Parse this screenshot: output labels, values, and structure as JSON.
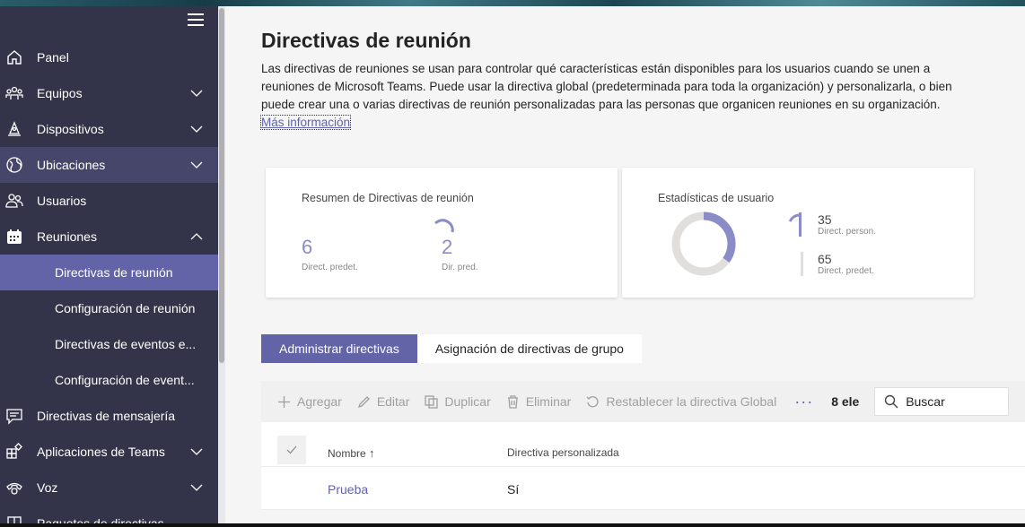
{
  "sidebar": {
    "items": [
      {
        "label": "Panel"
      },
      {
        "label": "Equipos"
      },
      {
        "label": "Dispositivos"
      },
      {
        "label": "Ubicaciones"
      },
      {
        "label": "Usuarios"
      },
      {
        "label": "Reuniones"
      },
      {
        "label": "Directivas de reunión"
      },
      {
        "label": "Configuración de reunión"
      },
      {
        "label": "Directivas de eventos e..."
      },
      {
        "label": "Configuración de event..."
      },
      {
        "label": "Directivas de mensajería"
      },
      {
        "label": "Aplicaciones de Teams"
      },
      {
        "label": "Voz"
      },
      {
        "label": "Paquetes de directivas"
      }
    ]
  },
  "page": {
    "title": "Directivas de reunión",
    "description": "Las directivas de reuniones se usan para controlar qué características están disponibles para los usuarios cuando se unen a reuniones de Microsoft Teams. Puede usar la directiva global (predeterminada para toda la organización) y personalizarla, o bien puede crear una o varias directivas de reunión personalizadas para las personas que organicen reuniones en su organización.",
    "more_info": "Más información"
  },
  "summary": {
    "title": "Resumen de Directivas de reunión",
    "default_value": "6",
    "default_label": "Direct. predet.",
    "pred_value": "2",
    "pred_label": "Dir. pred."
  },
  "user_stats": {
    "title": "Estadísticas de usuario",
    "custom_value": "35",
    "custom_label": "Direct. person.",
    "default_value": "65",
    "default_label": "Direct. predet.",
    "custom_fraction": 0.35,
    "accent": "#8b8cc7"
  },
  "tabs": [
    {
      "label": "Administrar directivas"
    },
    {
      "label": "Asignación de directivas de grupo"
    }
  ],
  "toolbar": {
    "add": "Agregar",
    "edit": "Editar",
    "duplicate": "Duplicar",
    "delete": "Eliminar",
    "reset": "Restablecer la directiva Global",
    "count": "8 ele",
    "search_placeholder": "Buscar"
  },
  "table": {
    "columns": [
      "Nombre",
      "Directiva personalizada"
    ],
    "rows": [
      {
        "name": "Prueba",
        "custom": "Sí"
      }
    ]
  }
}
